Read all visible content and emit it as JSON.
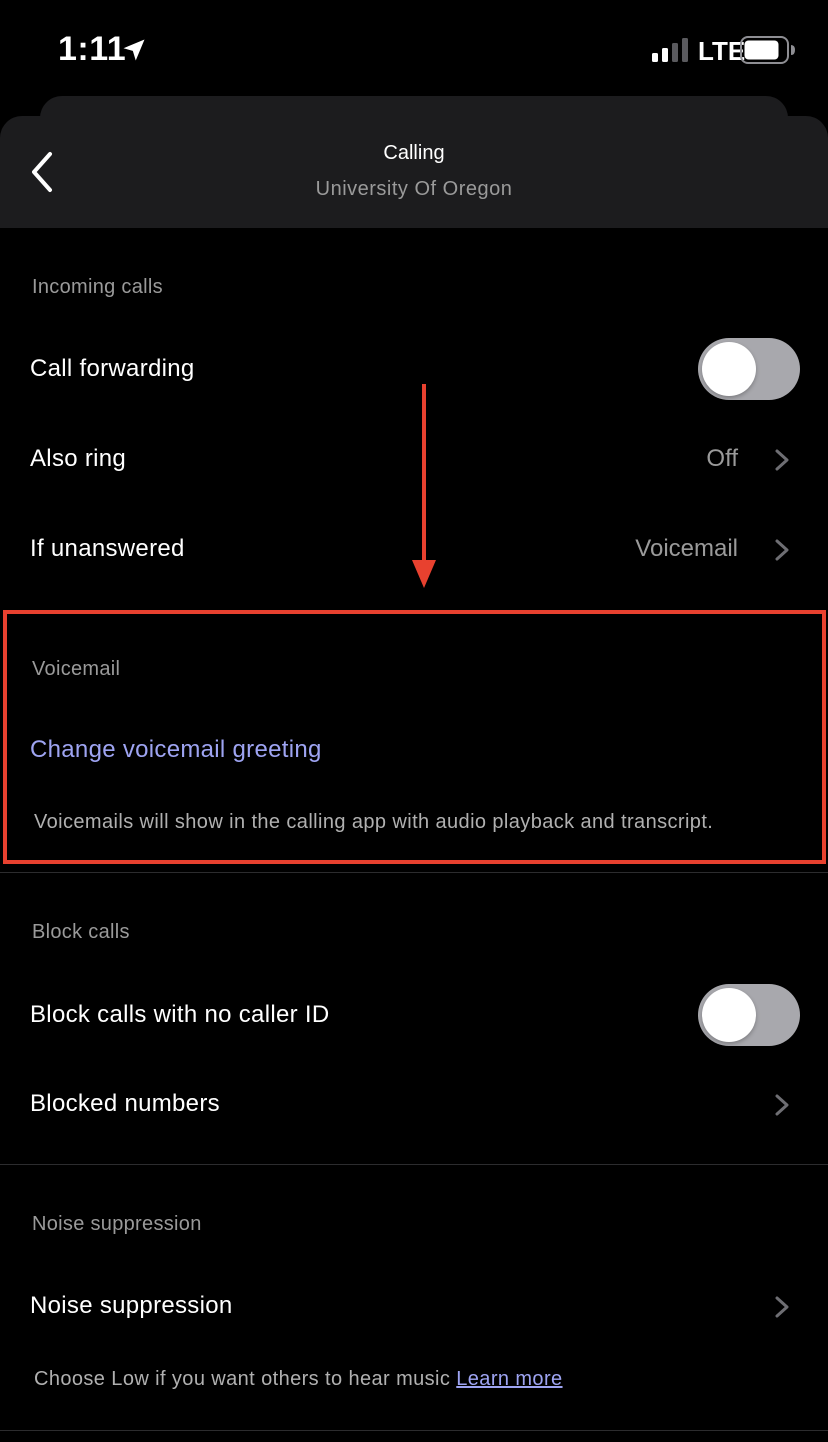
{
  "status_bar": {
    "time": "1:11",
    "network": "LTE",
    "icons": [
      "location-arrow-icon",
      "signal-bars-icon",
      "battery-icon"
    ]
  },
  "header": {
    "title": "Calling",
    "subtitle": "University Of Oregon",
    "back_icon": "chevron-left-icon"
  },
  "incoming_calls": {
    "section_label": "Incoming calls",
    "call_forwarding": {
      "label": "Call forwarding",
      "toggle_on": false
    },
    "also_ring": {
      "label": "Also ring",
      "value": "Off"
    },
    "if_unanswered": {
      "label": "If unanswered",
      "value": "Voicemail"
    }
  },
  "voicemail": {
    "section_label": "Voicemail",
    "change_greeting": "Change voicemail greeting",
    "note": "Voicemails will show in the calling app with audio playback and transcript."
  },
  "block_calls": {
    "section_label": "Block calls",
    "no_caller_id": {
      "label": "Block calls with no caller ID",
      "toggle_on": false
    },
    "blocked_numbers": {
      "label": "Blocked numbers"
    }
  },
  "noise_suppression": {
    "section_label": "Noise suppression",
    "row_label": "Noise suppression",
    "note": "Choose Low if you want others to hear music",
    "learn_more": "Learn more"
  },
  "colors": {
    "background": "#000000",
    "header_bg": "#1c1c1e",
    "secondary_text": "#9a9a9a",
    "link": "#9ea4f2",
    "annotation": "#e8412f",
    "toggle_off": "#a8a8ad"
  }
}
